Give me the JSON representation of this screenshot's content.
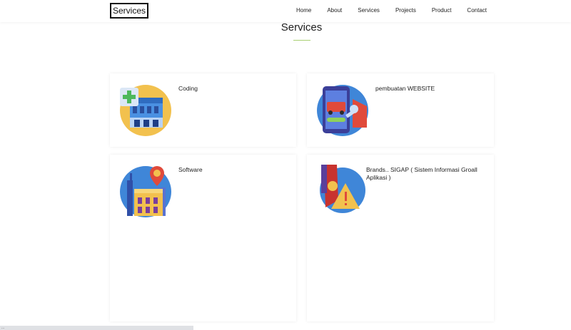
{
  "header": {
    "logo": "Services",
    "nav": [
      "Home",
      "About",
      "Services",
      "Projects",
      "Product",
      "Contact"
    ]
  },
  "section": {
    "title": "Services"
  },
  "services": [
    {
      "label": "Coding",
      "icon": "hospital-building-icon"
    },
    {
      "label": "pembuatan WEBSITE",
      "icon": "mobile-car-app-icon"
    },
    {
      "label": "Software",
      "icon": "city-location-pin-icon"
    },
    {
      "label": "Brands.. SIGAP ( Sistem Informasi Groall Aplikasi )",
      "icon": "warning-sign-icon"
    }
  ],
  "status": {
    "text": "..."
  },
  "colors": {
    "accent": "#a9cf72",
    "icon_blue": "#3f86d8"
  }
}
